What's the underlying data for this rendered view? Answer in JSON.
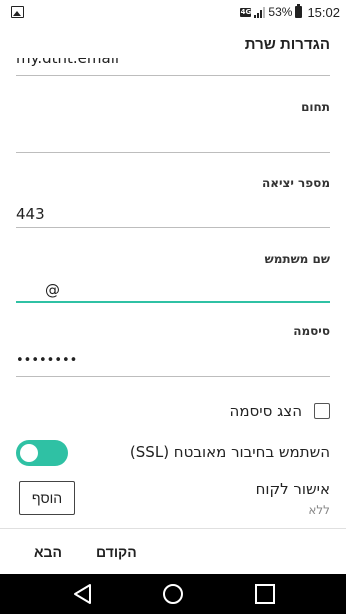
{
  "status_bar": {
    "network": "4G",
    "battery_percent": "53%",
    "time": "15:02",
    "icons": [
      "image-icon",
      "signal-icon",
      "battery-icon"
    ]
  },
  "header": {
    "title": "הגדרות שרת"
  },
  "fields": {
    "top_partial_value": "my.dtnt.email",
    "domain": {
      "label": "תחום",
      "value": ""
    },
    "port": {
      "label": "מספר יציאה",
      "value": "443"
    },
    "username": {
      "label": "שם משתמש",
      "value": "@"
    },
    "password": {
      "label": "סיסמה",
      "value": "••••••••"
    }
  },
  "show_password": {
    "label": "הצג סיסמה",
    "checked": false
  },
  "ssl": {
    "label": "השתמש בחיבור מאובטח (SSL)",
    "enabled": true
  },
  "client_certificate": {
    "label": "אישור לקוח",
    "value": "ללא",
    "add_label": "הוסף"
  },
  "actions": {
    "previous_label": "הקודם",
    "next_label": "הבא"
  },
  "colors": {
    "accent": "#2fc1a4"
  },
  "nav_bar": {
    "icons": [
      "back-icon",
      "home-icon",
      "recents-icon"
    ]
  }
}
